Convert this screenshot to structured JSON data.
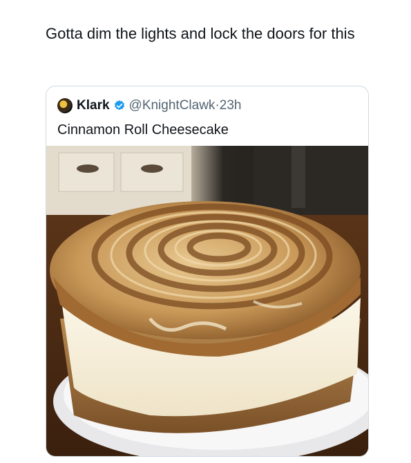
{
  "tweet": {
    "text": "Gotta dim the lights and lock the doors for this"
  },
  "quoted_tweet": {
    "display_name": "Klark",
    "handle": "@KnightClawk",
    "separator": "·",
    "time": "23h",
    "text": "Cinnamon Roll Cheesecake",
    "verified_color": "#1d9bf0",
    "avatar_icon": "avatar-icon",
    "verified_icon": "verified-badge-icon"
  },
  "photo": {
    "subject": "cinnamon-roll-cheesecake-photo"
  }
}
